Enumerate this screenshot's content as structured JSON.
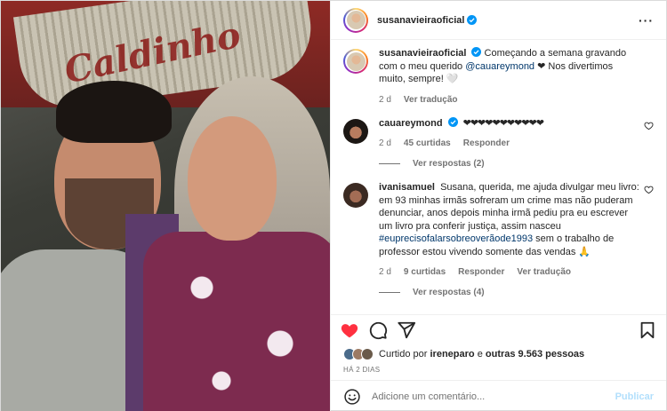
{
  "post": {
    "author": "susanavieiraoficial",
    "caption": {
      "text_before": "Começando a semana gravando com o meu querido ",
      "mention": "@cauareymond",
      "text_after": " ❤ Nos divertimos muito, sempre!",
      "emoji_end": "🤍",
      "age": "2 d",
      "translate": "Ver tradução"
    },
    "comments": [
      {
        "user": "cauareymond",
        "verified": true,
        "text": "❤❤❤❤❤❤❤❤❤❤❤",
        "age": "2 d",
        "likes": "45 curtidas",
        "reply": "Responder",
        "view_replies": "Ver respostas (2)"
      },
      {
        "user": "ivanisamuel",
        "verified": false,
        "text_before": "Susana, querida, me ajuda divulgar meu livro: em 93 minhas irmãs sofreram um crime mas não puderam denunciar, anos depois minha irmã pediu pra eu escrever um livro pra conferir justiça, assim nasceu ",
        "hashtag": "#euprecisofalarsobreoverãode1993",
        "text_after": " sem o trabalho de professor estou vivendo somente das vendas 🙏",
        "age": "2 d",
        "likes": "9 curtidas",
        "reply": "Responder",
        "translate": "Ver tradução",
        "view_replies": "Ver respostas (4)"
      }
    ],
    "liked_by": {
      "prefix": "Curtido por ",
      "user": "ireneparo",
      "middle": " e ",
      "others": "outras 9.563 pessoas"
    },
    "time_ago": "HÁ 2 DIAS",
    "comment_input": {
      "placeholder": "Adicione um comentário...",
      "value": ""
    },
    "publish_label": "Publicar",
    "photo_sign_text": "Caldinho"
  },
  "colors": {
    "like_red": "#ff3040",
    "verified_blue": "#0095f6",
    "link": "#00376b",
    "muted": "#737373",
    "publish_disabled": "#b2dffc"
  }
}
